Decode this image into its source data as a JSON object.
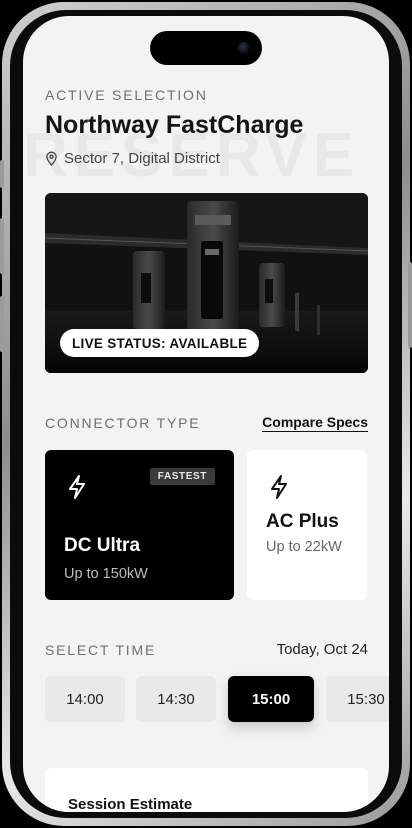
{
  "watermark": "RESERVE",
  "header": {
    "overline": "ACTIVE SELECTION",
    "title": "Northway FastCharge",
    "location": "Sector 7, Digital District"
  },
  "hero": {
    "status_label": "LIVE STATUS: AVAILABLE"
  },
  "connector": {
    "section_label": "CONNECTOR TYPE",
    "compare_link": "Compare Specs",
    "options": [
      {
        "name": "DC Ultra",
        "detail": "Up to 150kW",
        "badge": "FASTEST",
        "selected": true,
        "icon": "bolt-icon"
      },
      {
        "name": "AC Plus",
        "detail": "Up to 22kW",
        "selected": false,
        "icon": "bolt-icon"
      }
    ]
  },
  "time": {
    "section_label": "SELECT TIME",
    "date": "Today, Oct 24",
    "slots": [
      {
        "label": "14:00",
        "selected": false
      },
      {
        "label": "14:30",
        "selected": false
      },
      {
        "label": "15:00",
        "selected": true
      },
      {
        "label": "15:30",
        "selected": false
      }
    ]
  },
  "estimate": {
    "title": "Session Estimate"
  },
  "colors": {
    "background": "#f3f3f3",
    "accent": "#000000",
    "card_light": "#ffffff"
  }
}
